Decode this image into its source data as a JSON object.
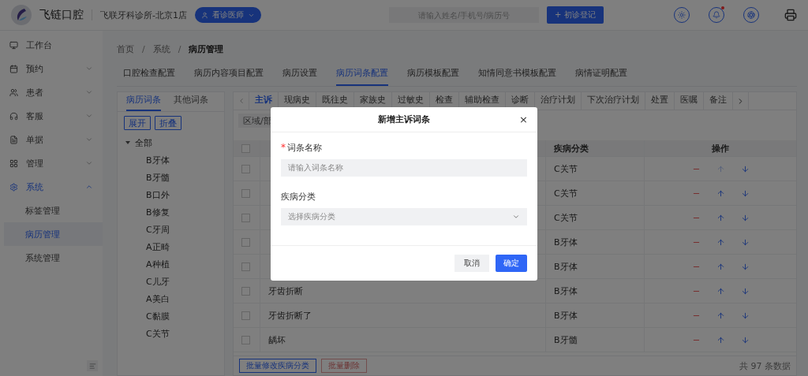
{
  "header": {
    "brand": "飞链口腔",
    "clinic": "飞联牙科诊所-北京1店",
    "role_button": "看诊医师",
    "search": {
      "placeholder": "请输入姓名/手机号/病历号"
    },
    "register_button": "+ 初诊登记",
    "notification_dot": true
  },
  "sidebar": {
    "items": [
      {
        "label": "工作台",
        "expandable": false,
        "selected": false
      },
      {
        "label": "预约",
        "expandable": true,
        "expanded": false,
        "selected": false
      },
      {
        "label": "患者",
        "expandable": true,
        "expanded": false,
        "selected": false
      },
      {
        "label": "客服",
        "expandable": true,
        "expanded": false,
        "selected": false
      },
      {
        "label": "单据",
        "expandable": true,
        "expanded": false,
        "selected": false
      },
      {
        "label": "管理",
        "expandable": true,
        "expanded": false,
        "selected": false
      },
      {
        "label": "系统",
        "expandable": true,
        "expanded": true,
        "selected": true,
        "children": [
          {
            "label": "标签管理",
            "selected": false
          },
          {
            "label": "病历管理",
            "selected": true
          },
          {
            "label": "系统管理",
            "selected": false
          }
        ]
      }
    ]
  },
  "breadcrumb": {
    "separator": "/",
    "items": [
      "首页",
      "系统",
      "病历管理"
    ]
  },
  "tabs": [
    {
      "label": "口腔检查配置",
      "selected": false
    },
    {
      "label": "病历内容项目配置",
      "selected": false
    },
    {
      "label": "病历设置",
      "selected": false
    },
    {
      "label": "病历词条配置",
      "selected": true
    },
    {
      "label": "病历模板配置",
      "selected": false
    },
    {
      "label": "知情同意书模板配置",
      "selected": false
    },
    {
      "label": "病情证明配置",
      "selected": false
    }
  ],
  "term_panel": {
    "tabs": [
      {
        "label": "病历词条",
        "selected": true
      },
      {
        "label": "其他词条",
        "selected": false
      }
    ],
    "buttons": [
      "展开",
      "折叠"
    ],
    "tree": [
      {
        "label": "全部",
        "expanded": true,
        "children": [
          {
            "label": "B牙体"
          },
          {
            "label": "B牙髓"
          },
          {
            "label": "B口外"
          },
          {
            "label": "B修复"
          },
          {
            "label": "C牙周"
          },
          {
            "label": "A正畸"
          },
          {
            "label": "A种植"
          },
          {
            "label": "C儿牙"
          },
          {
            "label": "A美白"
          },
          {
            "label": "C黏膜"
          },
          {
            "label": "C关节"
          }
        ]
      }
    ]
  },
  "sub_tabs": [
    {
      "label": "主诉",
      "selected": true
    },
    {
      "label": "现病史",
      "selected": false
    },
    {
      "label": "既往史",
      "selected": false
    },
    {
      "label": "家族史",
      "selected": false
    },
    {
      "label": "过敏史",
      "selected": false
    },
    {
      "label": "检查",
      "selected": false
    },
    {
      "label": "辅助检查",
      "selected": false
    },
    {
      "label": "诊断",
      "selected": false
    },
    {
      "label": "治疗计划",
      "selected": false
    },
    {
      "label": "下次治疗计划",
      "selected": false
    },
    {
      "label": "处置",
      "selected": false
    },
    {
      "label": "医嘱",
      "selected": false
    },
    {
      "label": "备注",
      "selected": false
    }
  ],
  "filter_chip": "区域/部",
  "table": {
    "all_checked": false,
    "columns": [
      {
        "label": "疾病分类"
      },
      {
        "label": "操作"
      }
    ],
    "rows": [
      {
        "checked": false,
        "category": "C关节",
        "up_disabled": true
      },
      {
        "checked": false,
        "category": "C关节",
        "up_disabled": false
      },
      {
        "checked": false,
        "category": "C关节",
        "up_disabled": false
      },
      {
        "checked": false,
        "category": "B牙体",
        "up_disabled": false
      },
      {
        "checked": false,
        "category": "B牙体",
        "up_disabled": false
      },
      {
        "checked": false,
        "name": "牙齿折断",
        "category": "B牙体",
        "up_disabled": false
      },
      {
        "checked": false,
        "name": "牙齿折断了",
        "category": "B牙体",
        "up_disabled": false
      },
      {
        "checked": false,
        "name": "龋坏",
        "category": "B牙髓",
        "up_disabled": false
      }
    ]
  },
  "footer": {
    "buttons": [
      {
        "label": "批量修改疾病分类",
        "disabled": false
      },
      {
        "label": "批量删除",
        "disabled": true
      }
    ],
    "total": "共 97 条数据"
  },
  "dialog": {
    "title": "新增主诉词条",
    "close": "×",
    "required_mark": "*",
    "fields": [
      {
        "kind": "input",
        "label": "词条名称",
        "required": true,
        "placeholder": "请输入词条名称"
      },
      {
        "kind": "select",
        "label": "疾病分类",
        "required": false,
        "placeholder": "选择疾病分类"
      }
    ],
    "cancel": "取消",
    "confirm": "确定"
  }
}
